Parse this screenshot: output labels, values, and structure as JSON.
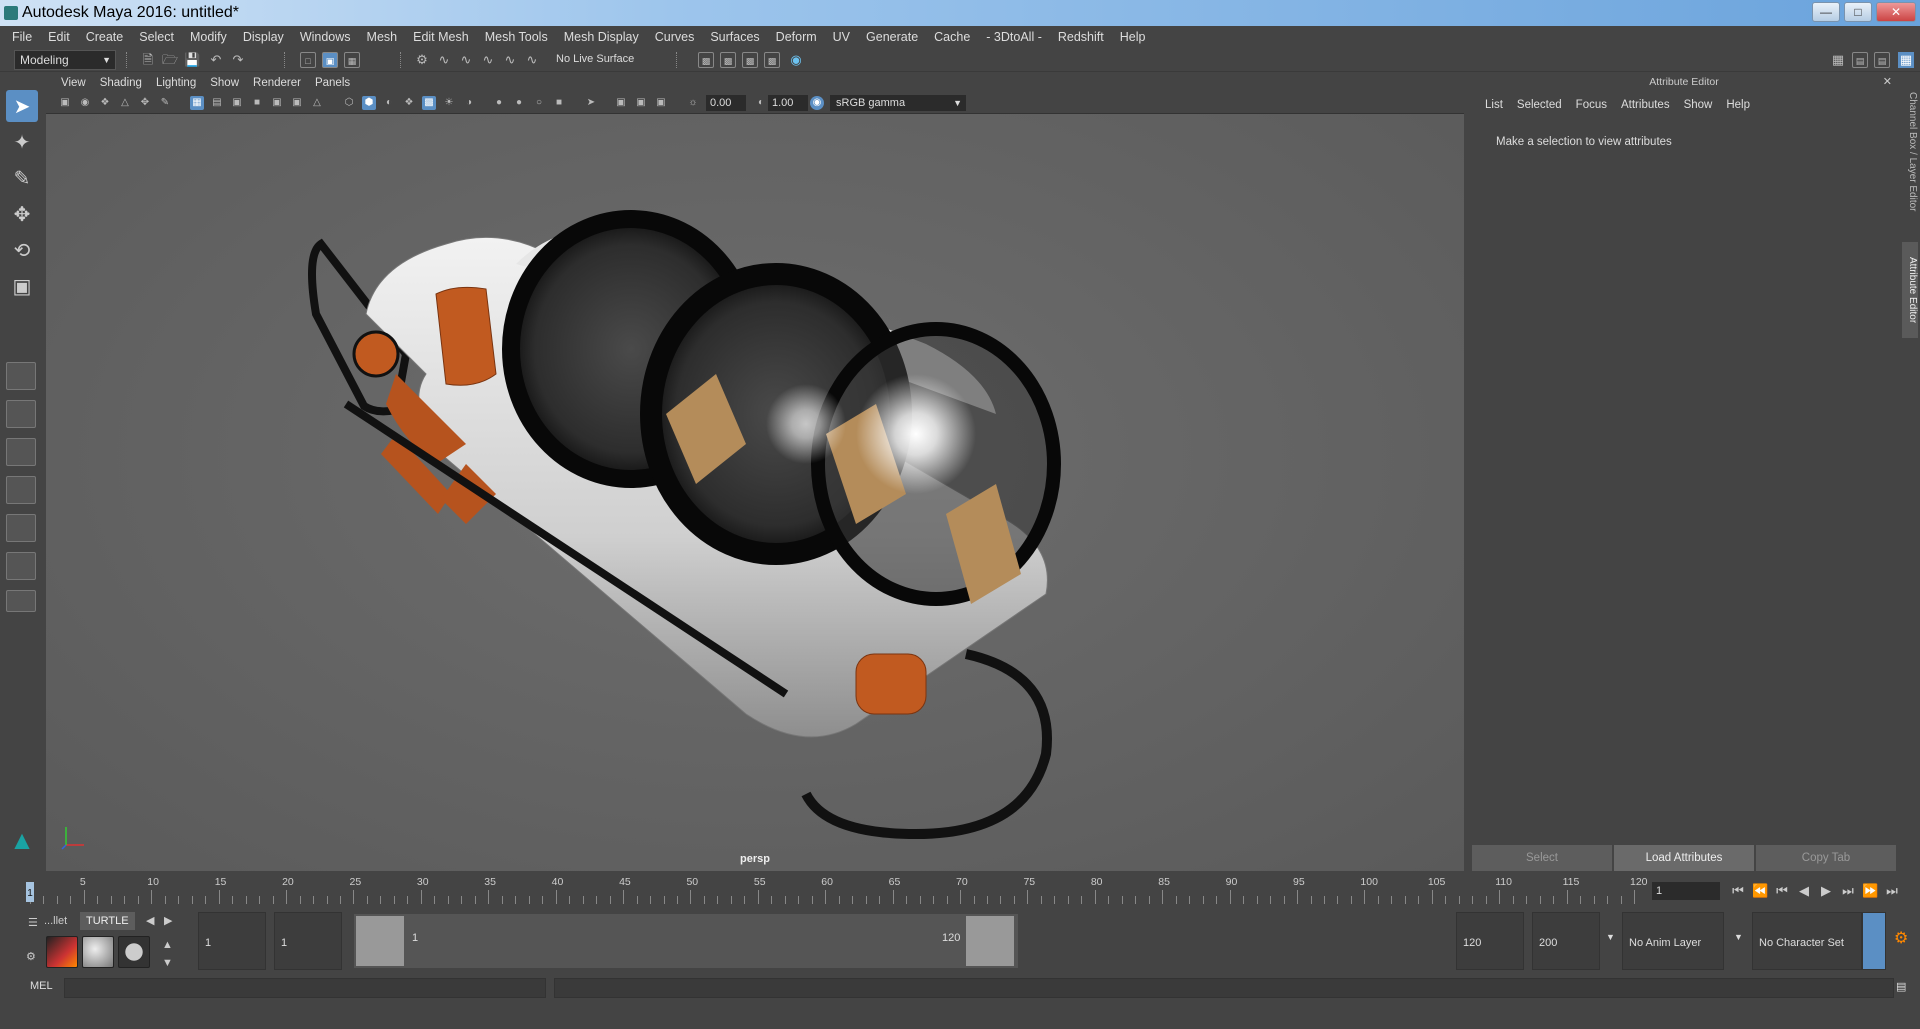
{
  "window": {
    "title": "Autodesk Maya 2016: untitled*"
  },
  "menubar": [
    "File",
    "Edit",
    "Create",
    "Select",
    "Modify",
    "Display",
    "Windows",
    "Mesh",
    "Edit Mesh",
    "Mesh Tools",
    "Mesh Display",
    "Curves",
    "Surfaces",
    "Deform",
    "UV",
    "Generate",
    "Cache",
    "- 3DtoAll -",
    "Redshift",
    "Help"
  ],
  "status": {
    "mode": "Modeling",
    "live_surface": "No Live Surface"
  },
  "viewport": {
    "menu": [
      "View",
      "Shading",
      "Lighting",
      "Show",
      "Renderer",
      "Panels"
    ],
    "exposure": "0.00",
    "gamma": "1.00",
    "color_space": "sRGB gamma",
    "camera_label": "persp"
  },
  "attribute_editor": {
    "title": "Attribute Editor",
    "menu": [
      "List",
      "Selected",
      "Focus",
      "Attributes",
      "Show",
      "Help"
    ],
    "message": "Make a selection to view attributes",
    "buttons": {
      "select": "Select",
      "load": "Load Attributes",
      "copy": "Copy Tab"
    }
  },
  "side_tabs": {
    "channel_box": "Channel Box / Layer Editor",
    "attribute_editor": "Attribute Editor"
  },
  "timeline": {
    "ticks": [
      "5",
      "10",
      "15",
      "20",
      "25",
      "30",
      "35",
      "40",
      "45",
      "50",
      "55",
      "60",
      "65",
      "70",
      "75",
      "80",
      "85",
      "90",
      "95",
      "100",
      "105",
      "110",
      "115",
      "120"
    ],
    "current_frame_marker": "1",
    "current_frame": "1"
  },
  "range": {
    "shelf_tabs": [
      "...llet",
      "TURTLE"
    ],
    "start_frame": "1",
    "playback_start": "1",
    "slider_start": "1",
    "slider_end": "120",
    "playback_end": "120",
    "end_frame": "200",
    "anim_layer": "No Anim Layer",
    "character_set": "No Character Set"
  },
  "command_line": {
    "label": "MEL"
  },
  "colors": {
    "accent": "#5b8fc4",
    "background": "#444444",
    "viewport": "#666666"
  }
}
